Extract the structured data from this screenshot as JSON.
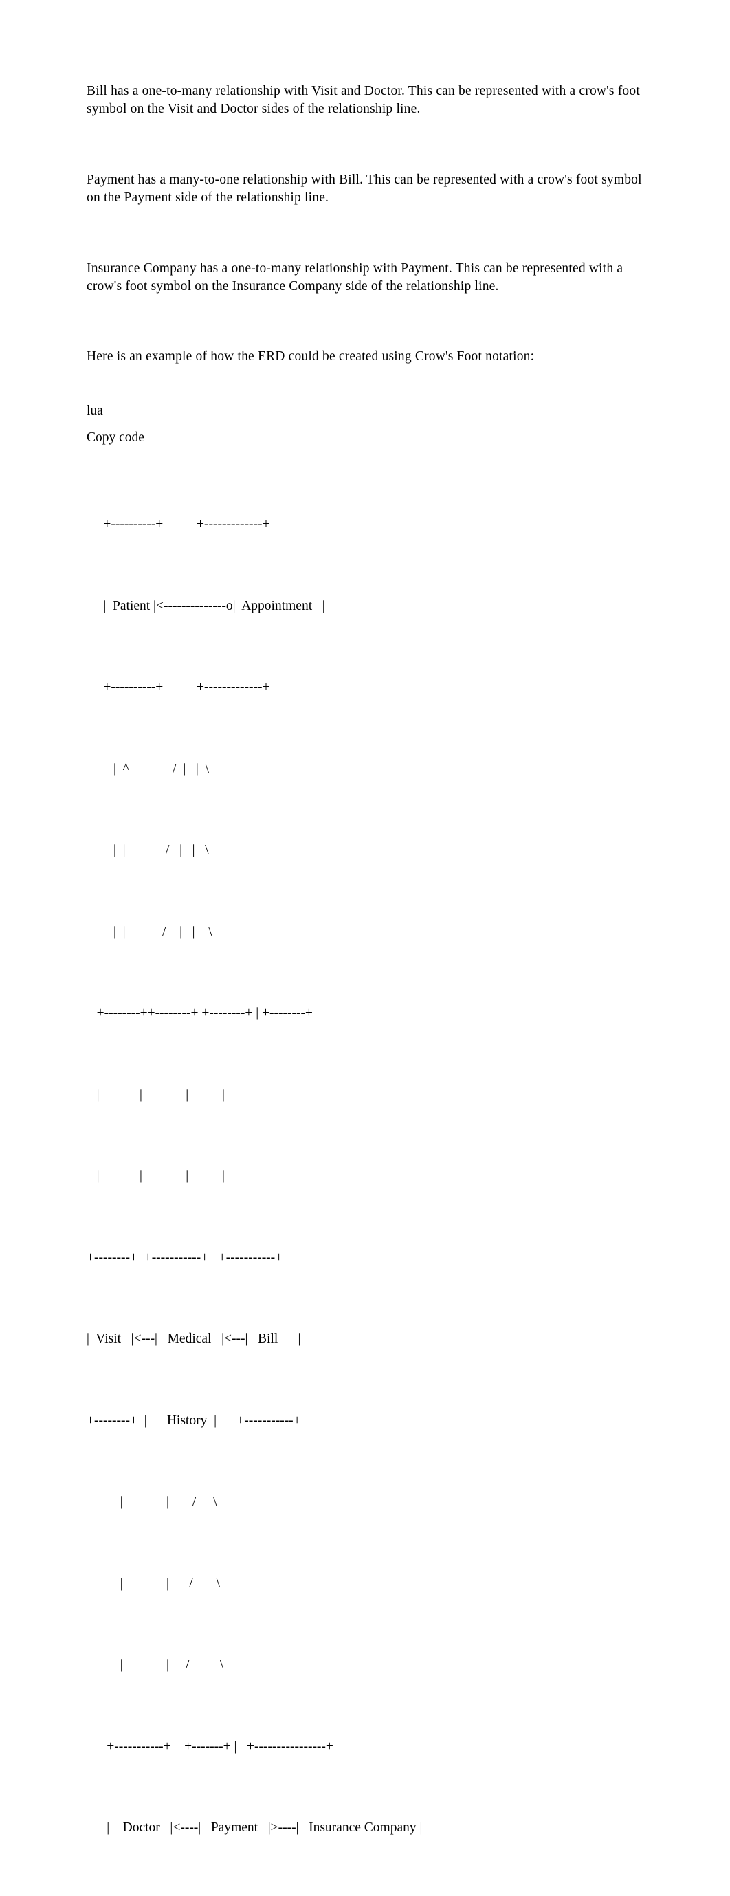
{
  "document": {
    "background_color": "#ffffff",
    "text_color": "#000000",
    "paragraphs": [
      {
        "id": "bill-relationship",
        "text": "Bill has a one-to-many relationship with Visit and Doctor. This can be represented with a crow's foot symbol on the Visit and Doctor sides of the relationship line."
      },
      {
        "id": "payment-relationship",
        "text": "Payment has a many-to-one relationship with Bill. This can be represented with a crow's foot symbol on the Payment side of the relationship line."
      },
      {
        "id": "insurance-relationship",
        "text": "Insurance Company has a one-to-many relationship with Payment. This can be represented with a crow's foot symbol on the Insurance Company side of the relationship line."
      },
      {
        "id": "erd-example-intro",
        "text": "Here is an example of how the ERD could be created using Crow's Foot notation:"
      }
    ],
    "code_block": {
      "language_label": "lua",
      "copy_label": "Copy code",
      "lines": [
        "     +----------+          +-------------+",
        "     |  Patient |<--------------o|  Appointment   |",
        "     +----------+          +-------------+",
        "        |  ^             /  |   |  \\",
        "        |  |            /   |   |   \\",
        "        |  |           /    |   |    \\",
        "   +--------++--------+ +--------+ | +--------+",
        "   |            |             |          |",
        "   |            |             |          |",
        "+--------+  +-----------+   +-----------+",
        "|  Visit   |<---|   Medical   |<---|   Bill      |",
        "+--------+  |      History  |      +-----------+",
        "          |             |       /     \\",
        "          |             |      /       \\",
        "          |             |     /         \\",
        "      +-----------+    +-------+ |   +----------------+",
        "      |    Doctor   |<----|   Payment   |>----|   Insurance Company |"
      ],
      "entities": [
        "Patient",
        "Appointment",
        "Visit",
        "Medical History",
        "Bill",
        "Doctor",
        "Payment",
        "Insurance Company"
      ]
    }
  }
}
